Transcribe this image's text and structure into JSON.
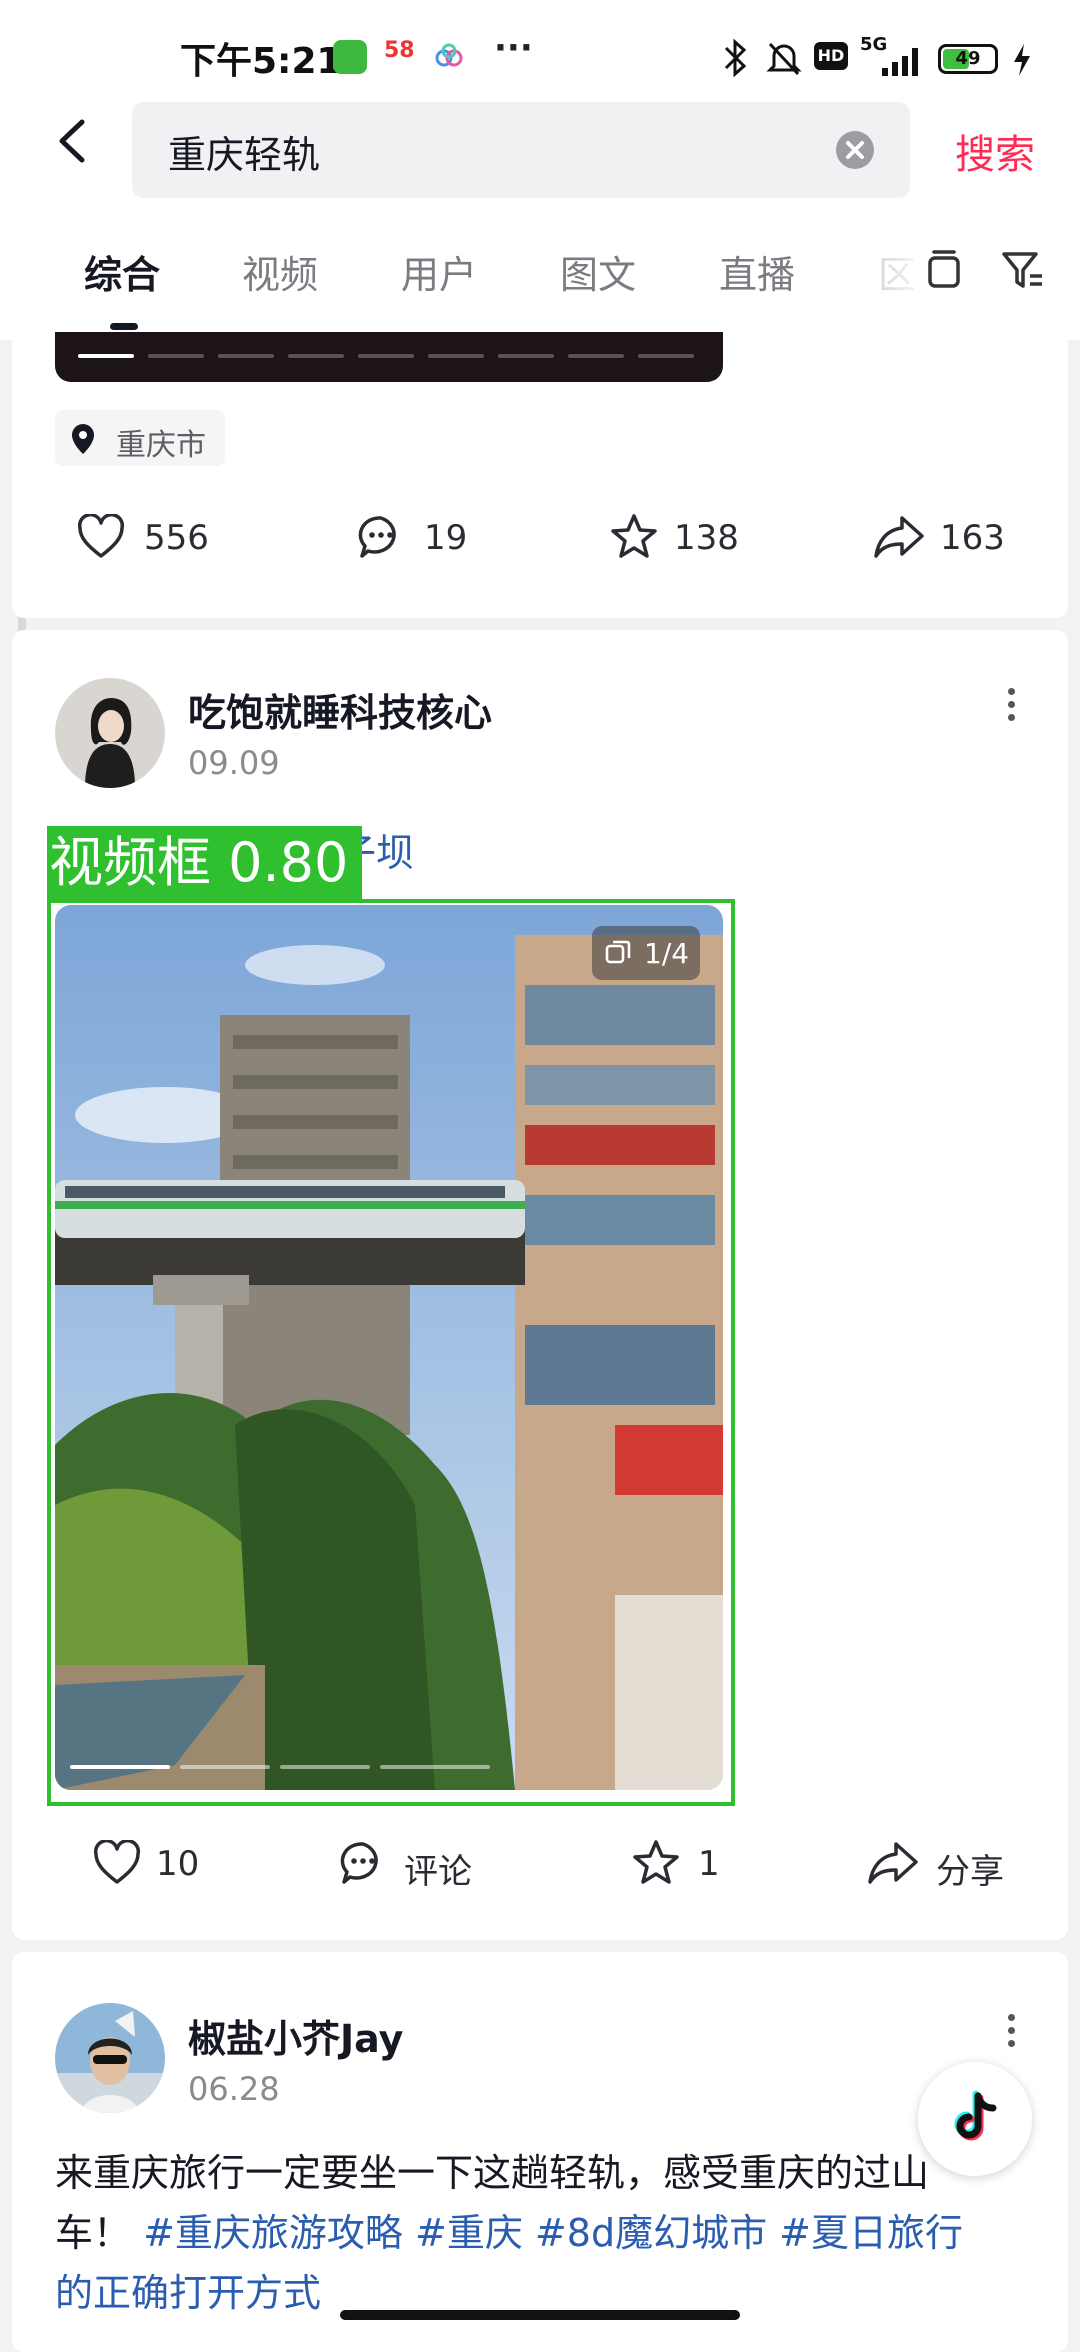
{
  "status_bar": {
    "time": "下午5:21",
    "app_badge_58": "58",
    "network": "5G",
    "hd": "HD",
    "battery": "49",
    "more": "···"
  },
  "header": {
    "query": "重庆轻轨",
    "search_label": "搜索"
  },
  "tabs": [
    {
      "label": "综合",
      "active": true
    },
    {
      "label": "视频"
    },
    {
      "label": "用户"
    },
    {
      "label": "图文"
    },
    {
      "label": "直播"
    },
    {
      "label": "区"
    }
  ],
  "prev_post": {
    "location": "重庆市",
    "likes": "556",
    "comments": "19",
    "favorites": "138",
    "shares": "163"
  },
  "post": {
    "author": "吃饱就睡科技核心",
    "date": "09.09",
    "tag_visible": "李子坝",
    "image_counter": "1/4",
    "detection_label": "视频框 0.80",
    "likes": "10",
    "comments_label": "评论",
    "favorites": "1",
    "share_label": "分享"
  },
  "next_post": {
    "author": "椒盐小芥Jay",
    "date": "06.28",
    "text_line1": "来重庆旅行一定要坐一下这趟轻轨，感受重庆的过山",
    "text_line2_prefix": "车！ ",
    "hashtags_line2": "#重庆旅游攻略 #重庆 #8d魔幻城市 #夏日旅行",
    "text_line3": "的正确打开方式"
  },
  "colors": {
    "accent": "#fe2c55",
    "hashtag": "#2a5db0",
    "detection": "#2fbf2f"
  }
}
